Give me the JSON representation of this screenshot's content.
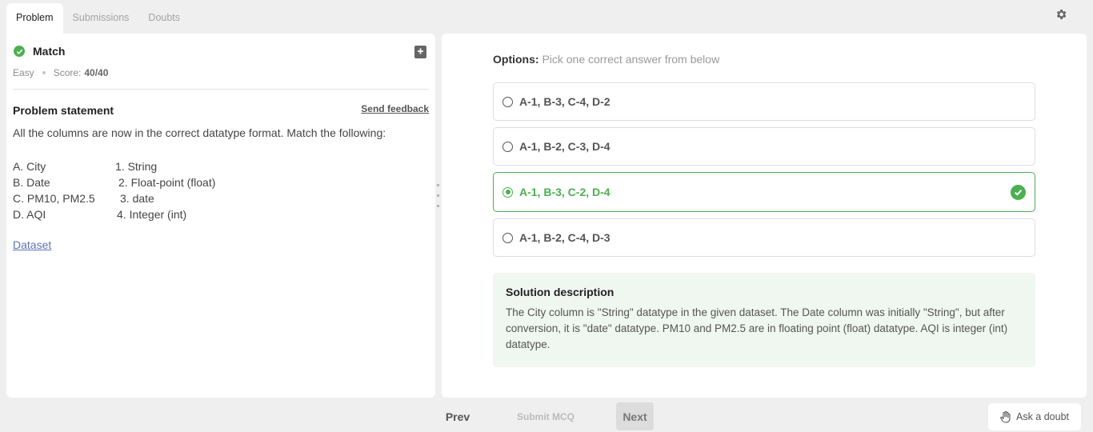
{
  "tabs": [
    {
      "label": "Problem"
    },
    {
      "label": "Submissions"
    },
    {
      "label": "Doubts"
    }
  ],
  "problem": {
    "title": "Match",
    "difficulty": "Easy",
    "score_label": "Score:",
    "score_value": "40/40",
    "statement_heading": "Problem statement",
    "send_feedback": "Send feedback",
    "statement_text": "All the columns are now in the correct datatype format. Match the following:",
    "match_rows": [
      {
        "left": "A. City",
        "right": "1. String"
      },
      {
        "left": "B. Date",
        "right": "2. Float-point (float)"
      },
      {
        "left": "C. PM10, PM2.5",
        "right": "3. date"
      },
      {
        "left": "D. AQI",
        "right": "4. Integer (int)"
      }
    ],
    "dataset_link": "Dataset"
  },
  "options": {
    "heading_label": "Options:",
    "heading_sub": "Pick one correct answer from below",
    "items": [
      {
        "label": "A-1, B-3, C-4, D-2",
        "state": "unselected"
      },
      {
        "label": "A-1, B-2, C-3, D-4",
        "state": "unselected"
      },
      {
        "label": "A-1, B-3, C-2, D-4",
        "state": "selected-correct"
      },
      {
        "label": "A-1, B-2, C-4, D-3",
        "state": "unselected"
      }
    ]
  },
  "solution": {
    "title": "Solution description",
    "text": "The City column is \"String\" datatype in the given dataset. The Date column was initially \"String\", but after conversion, it is \"date\" datatype. PM10 and PM2.5 are in floating point (float) datatype. AQI is integer (int) datatype."
  },
  "footer": {
    "prev": "Prev",
    "submit": "Submit MCQ",
    "next": "Next",
    "ask_doubt": "Ask a doubt"
  },
  "colors": {
    "accent_green": "#4caf50",
    "link_blue": "#5b74b8",
    "solution_bg": "#f0f6f0"
  },
  "icons": [
    "gear-icon",
    "check-circle-icon",
    "bookmark-add-icon",
    "radio-icon",
    "hand-icon"
  ]
}
